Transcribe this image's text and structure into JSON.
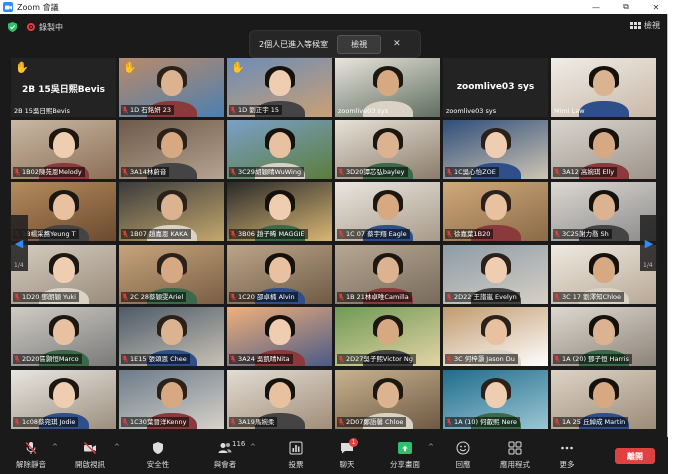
{
  "window": {
    "title": "Zoom 會議",
    "minimize": "—",
    "maximize": "⧉",
    "close": "✕"
  },
  "meeting": {
    "recording_label": "錄製中",
    "view_label": "檢視"
  },
  "waiting_room": {
    "message": "2個人已進入等候室",
    "view_button": "檢視",
    "close": "✕"
  },
  "navigation": {
    "page_left": "1/4",
    "page_right": "1/4",
    "prev": "◀",
    "next": "▶"
  },
  "participants": [
    {
      "name": "2B 15吳日熙Bevis",
      "display": "2B 15吳日熙Bevis",
      "video": false,
      "muted": false,
      "hand": true
    },
    {
      "name": "1D 石銘妍 23",
      "video": true,
      "muted": true,
      "hand": true
    },
    {
      "name": "1D 劉正宇 15",
      "video": true,
      "muted": true,
      "hand": true
    },
    {
      "name": "zoomlive03 sys",
      "video": true,
      "muted": false,
      "active": true
    },
    {
      "name": "zoomlive03 sys",
      "display": "zoomlive03 sys",
      "video": false,
      "muted": false
    },
    {
      "name": "Mimi Law",
      "video": true,
      "muted": false
    },
    {
      "name": "1B02陳苑恩Melody",
      "video": true,
      "muted": true
    },
    {
      "name": "3A14林蔚音",
      "video": true,
      "muted": true
    },
    {
      "name": "3C29胡穎晴WuWing",
      "video": true,
      "muted": true
    },
    {
      "name": "3D20譚芯弘bayley",
      "video": true,
      "muted": true
    },
    {
      "name": "1C吳心怡ZOE",
      "video": true,
      "muted": true
    },
    {
      "name": "3A12 高婉琪 Elly",
      "video": true,
      "muted": true
    },
    {
      "name": "1B楊采蕎Yeung T",
      "video": true,
      "muted": true
    },
    {
      "name": "1B07 趙嘉恩 KAKA",
      "video": true,
      "muted": true
    },
    {
      "name": "3B06 趙子晞 MAGGIE",
      "video": true,
      "muted": true
    },
    {
      "name": "1C 07 蔡宇翔 Eagle",
      "video": true,
      "muted": true
    },
    {
      "name": "徐嘉葉1B20",
      "video": true,
      "muted": true
    },
    {
      "name": "3C25謝力喬 Sh",
      "video": true,
      "muted": true
    },
    {
      "name": "1D20 鄧朗穎 Yuki",
      "video": true,
      "muted": true
    },
    {
      "name": "2C 28蔡穎雯Ariel",
      "video": true,
      "muted": true
    },
    {
      "name": "1C20 邵卓楠 Alvin",
      "video": true,
      "muted": true
    },
    {
      "name": "1B 21林卓唯Camilla",
      "video": true,
      "muted": true
    },
    {
      "name": "2D22 王譜嵐 Evelyn",
      "video": true,
      "muted": true
    },
    {
      "name": "3C 17 劉澤知Chloe",
      "video": true,
      "muted": true
    },
    {
      "name": "2D20區顥恒Marco",
      "video": true,
      "muted": true
    },
    {
      "name": "1E15 張頌恩 Chee",
      "video": true,
      "muted": true
    },
    {
      "name": "3A24 吳凱晴Nita",
      "video": true,
      "muted": true
    },
    {
      "name": "2D27吳子熙Victor Ng",
      "video": true,
      "muted": true
    },
    {
      "name": "3C 何梓灝 Jason Du",
      "video": true,
      "muted": true
    },
    {
      "name": "1A (20) 鄧子恒 Harris",
      "video": true,
      "muted": true
    },
    {
      "name": "1c08蔡宛琪 Jodie",
      "video": true,
      "muted": true
    },
    {
      "name": "1C30葉晉洋Kenny",
      "video": true,
      "muted": true
    },
    {
      "name": "3A19馬婉柔",
      "video": true,
      "muted": true
    },
    {
      "name": "2D07鄭語馨 Chloe",
      "video": true,
      "muted": true
    },
    {
      "name": "1A (10) 何叡熙 Nere",
      "video": true,
      "muted": true
    },
    {
      "name": "1A 25 丘綽成 Martin",
      "video": true,
      "muted": true
    }
  ],
  "toolbar": {
    "unmute": "解除靜音",
    "start_video": "開啟視訊",
    "security": "安全性",
    "participants": "與會者",
    "participants_count": "116",
    "polls": "投票",
    "chat": "聊天",
    "chat_badge": "1",
    "share": "分享畫面",
    "reactions": "回應",
    "apps": "應用程式",
    "more": "更多",
    "end": "離開",
    "caret": "^"
  },
  "colors": {
    "accent": "#2d8cff",
    "end": "#e0403f",
    "share": "#2fc06c",
    "active_speaker": "#a7d13a",
    "raised_hand": "#f3c24b"
  }
}
